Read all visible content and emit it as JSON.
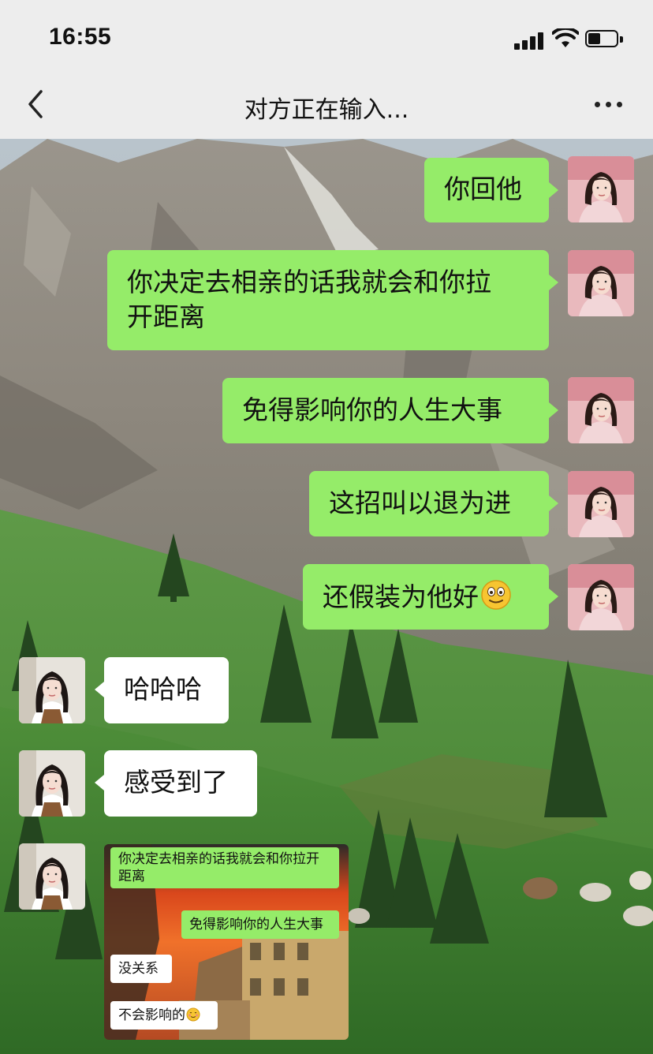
{
  "status_bar": {
    "time": "16:55",
    "battery_level": 0.45
  },
  "nav": {
    "title": "对方正在输入...",
    "back_icon": "chevron-left-icon",
    "more_icon": "more-dots-icon"
  },
  "messages": [
    {
      "side": "sent",
      "text": "你回他"
    },
    {
      "side": "sent",
      "text_line1": "你决定去相亲的话我就会和你拉",
      "text_line2": "开距离"
    },
    {
      "side": "sent",
      "text": "免得影响你的人生大事"
    },
    {
      "side": "sent",
      "text": "这招叫以退为进"
    },
    {
      "side": "sent",
      "text": "还假装为他好",
      "emoji": "smiley-emoji-icon"
    },
    {
      "side": "received",
      "text": "哈哈哈"
    },
    {
      "side": "received",
      "text": "感受到了"
    }
  ],
  "image_message": {
    "sent_1": "你决定去相亲的话我就会和你拉开",
    "sent_1b": "距离",
    "sent_2": "免得影响你的人生大事",
    "recv_1": "没关系",
    "recv_2": "不会影响的",
    "recv_2_emoji": "blush-emoji-icon"
  },
  "colors": {
    "sent_bubble": "#95ec69",
    "received_bubble": "#ffffff",
    "nav_bg": "#ededed"
  }
}
